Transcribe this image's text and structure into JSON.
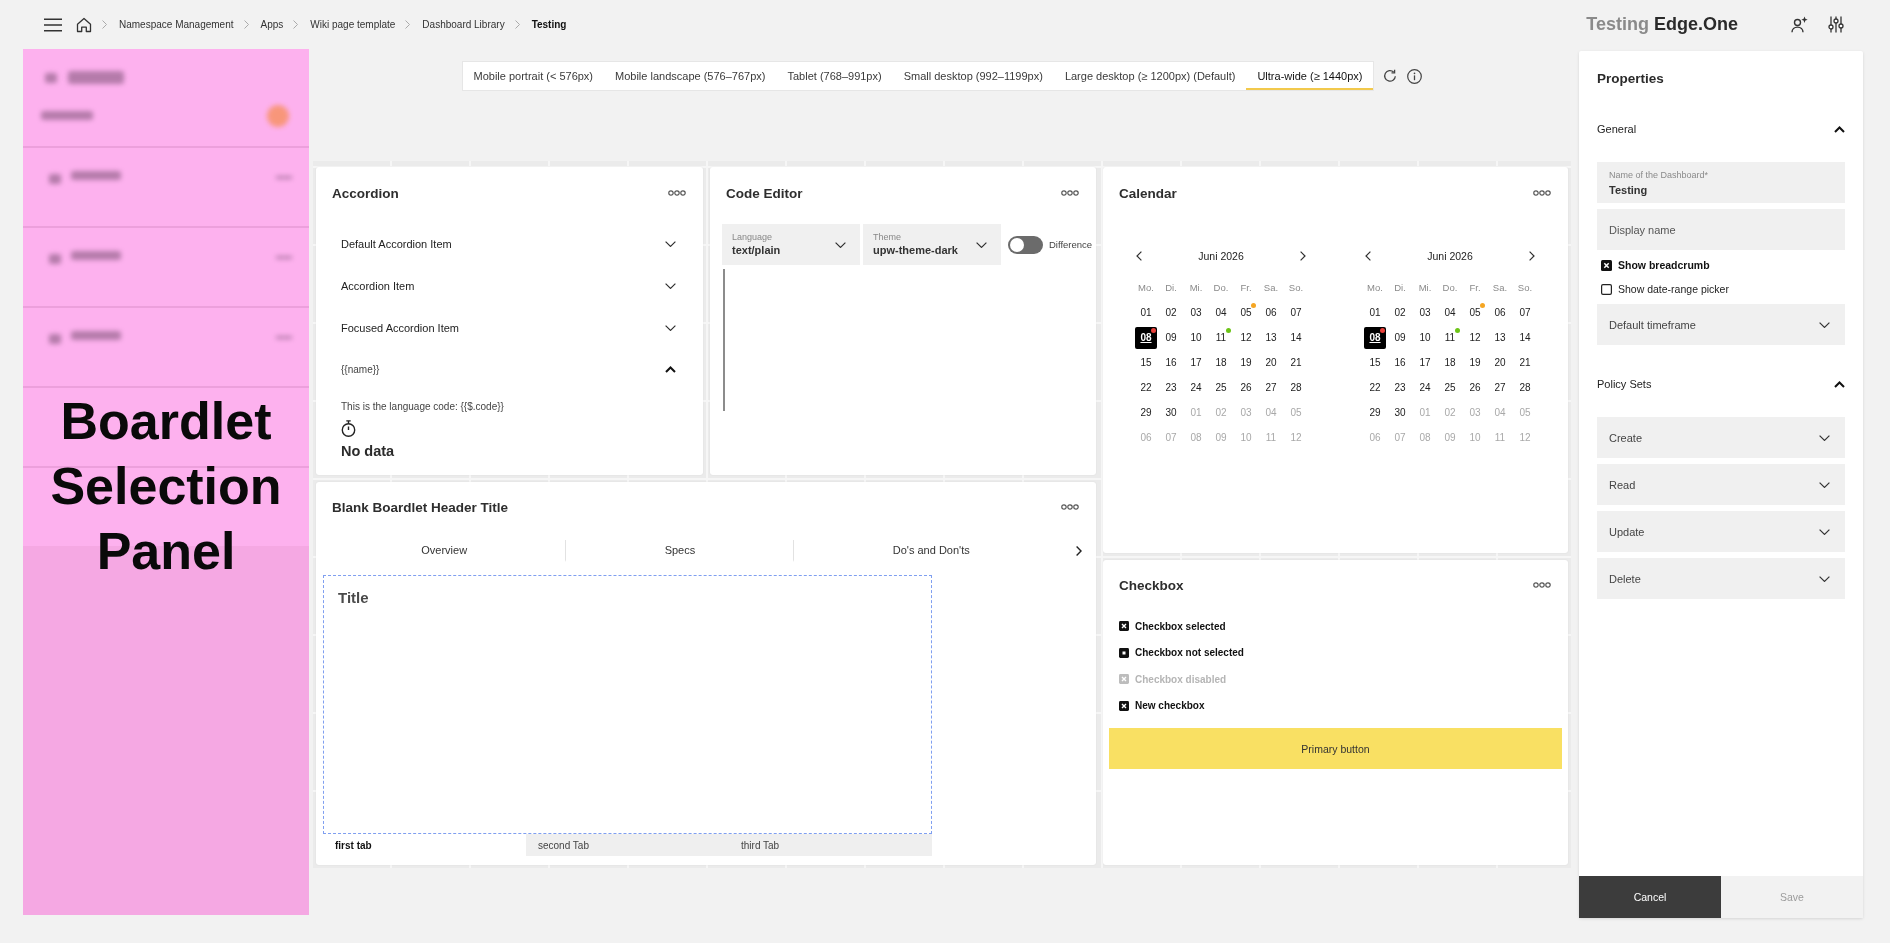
{
  "topbar": {
    "breadcrumb": [
      {
        "label": "Namespace Management",
        "current": false
      },
      {
        "label": "Apps",
        "current": false
      },
      {
        "label": "Wiki page template",
        "current": false
      },
      {
        "label": "Dashboard Library",
        "current": false
      },
      {
        "label": "Testing",
        "current": true
      }
    ],
    "brand": {
      "prefix": "Testing",
      "name": "Edge.One"
    }
  },
  "boardlet_panel": {
    "label": "Boardlet Selection Panel"
  },
  "breakpoints": {
    "tabs": [
      {
        "label": "Mobile portrait (< 576px)",
        "selected": false
      },
      {
        "label": "Mobile landscape (576–767px)",
        "selected": false
      },
      {
        "label": "Tablet (768–991px)",
        "selected": false
      },
      {
        "label": "Small desktop (992–1199px)",
        "selected": false
      },
      {
        "label": "Large desktop (≥ 1200px) (Default)",
        "selected": false
      },
      {
        "label": "Ultra-wide (≥ 1440px)",
        "selected": true
      }
    ]
  },
  "accordion": {
    "title": "Accordion",
    "items": [
      {
        "label": "Default Accordion Item",
        "expanded": false
      },
      {
        "label": "Accordion Item",
        "expanded": false
      },
      {
        "label": "Focused Accordion Item",
        "expanded": false
      },
      {
        "label": "{{name}}",
        "expanded": true,
        "content": "This is the language code: {{$.code}}",
        "empty_label": "No data"
      }
    ]
  },
  "code_editor": {
    "title": "Code Editor",
    "selects": [
      {
        "label": "Language",
        "value": "text/plain"
      },
      {
        "label": "Theme",
        "value": "upw-theme-dark"
      }
    ],
    "toggle": {
      "label": "Difference",
      "on": false
    }
  },
  "calendar": {
    "title": "Calendar",
    "months": [
      {
        "title": "Juni 2026",
        "weekdays": [
          "Mo.",
          "Di.",
          "Mi.",
          "Do.",
          "Fr.",
          "Sa.",
          "So."
        ],
        "days": [
          {
            "d": "01",
            "outside": false,
            "selected": false
          },
          {
            "d": "02",
            "outside": false,
            "selected": false
          },
          {
            "d": "03",
            "outside": false,
            "selected": false
          },
          {
            "d": "04",
            "outside": false,
            "selected": false
          },
          {
            "d": "05",
            "outside": false,
            "selected": false,
            "color": "#f5a623"
          },
          {
            "d": "06",
            "outside": false,
            "selected": false
          },
          {
            "d": "07",
            "outside": false,
            "selected": false
          },
          {
            "d": "08",
            "outside": false,
            "selected": true,
            "color": "#e8403a"
          },
          {
            "d": "09",
            "outside": false,
            "selected": false
          },
          {
            "d": "10",
            "outside": false,
            "selected": false
          },
          {
            "d": "11",
            "outside": false,
            "selected": false,
            "color": "#6cc417"
          },
          {
            "d": "12",
            "outside": false,
            "selected": false
          },
          {
            "d": "13",
            "outside": false,
            "selected": false
          },
          {
            "d": "14",
            "outside": false,
            "selected": false
          },
          {
            "d": "15",
            "outside": false,
            "selected": false
          },
          {
            "d": "16",
            "outside": false,
            "selected": false
          },
          {
            "d": "17",
            "outside": false,
            "selected": false
          },
          {
            "d": "18",
            "outside": false,
            "selected": false
          },
          {
            "d": "19",
            "outside": false,
            "selected": false
          },
          {
            "d": "20",
            "outside": false,
            "selected": false
          },
          {
            "d": "21",
            "outside": false,
            "selected": false
          },
          {
            "d": "22",
            "outside": false,
            "selected": false
          },
          {
            "d": "23",
            "outside": false,
            "selected": false
          },
          {
            "d": "24",
            "outside": false,
            "selected": false
          },
          {
            "d": "25",
            "outside": false,
            "selected": false
          },
          {
            "d": "26",
            "outside": false,
            "selected": false
          },
          {
            "d": "27",
            "outside": false,
            "selected": false
          },
          {
            "d": "28",
            "outside": false,
            "selected": false
          },
          {
            "d": "29",
            "outside": false,
            "selected": false
          },
          {
            "d": "30",
            "outside": false,
            "selected": false
          },
          {
            "d": "01",
            "outside": true,
            "selected": false
          },
          {
            "d": "02",
            "outside": true,
            "selected": false
          },
          {
            "d": "03",
            "outside": true,
            "selected": false
          },
          {
            "d": "04",
            "outside": true,
            "selected": false
          },
          {
            "d": "05",
            "outside": true,
            "selected": false
          },
          {
            "d": "06",
            "outside": true,
            "selected": false
          },
          {
            "d": "07",
            "outside": true,
            "selected": false
          },
          {
            "d": "08",
            "outside": true,
            "selected": false
          },
          {
            "d": "09",
            "outside": true,
            "selected": false
          },
          {
            "d": "10",
            "outside": true,
            "selected": false
          },
          {
            "d": "11",
            "outside": true,
            "selected": false
          },
          {
            "d": "12",
            "outside": true,
            "selected": false
          }
        ]
      },
      {
        "title": "Juni 2026",
        "weekdays": [
          "Mo.",
          "Di.",
          "Mi.",
          "Do.",
          "Fr.",
          "Sa.",
          "So."
        ],
        "days": [
          {
            "d": "01",
            "outside": false,
            "selected": false
          },
          {
            "d": "02",
            "outside": false,
            "selected": false
          },
          {
            "d": "03",
            "outside": false,
            "selected": false
          },
          {
            "d": "04",
            "outside": false,
            "selected": false
          },
          {
            "d": "05",
            "outside": false,
            "selected": false,
            "color": "#f5a623"
          },
          {
            "d": "06",
            "outside": false,
            "selected": false
          },
          {
            "d": "07",
            "outside": false,
            "selected": false
          },
          {
            "d": "08",
            "outside": false,
            "selected": true,
            "color": "#e8403a"
          },
          {
            "d": "09",
            "outside": false,
            "selected": false
          },
          {
            "d": "10",
            "outside": false,
            "selected": false
          },
          {
            "d": "11",
            "outside": false,
            "selected": false,
            "color": "#6cc417"
          },
          {
            "d": "12",
            "outside": false,
            "selected": false
          },
          {
            "d": "13",
            "outside": false,
            "selected": false
          },
          {
            "d": "14",
            "outside": false,
            "selected": false
          },
          {
            "d": "15",
            "outside": false,
            "selected": false
          },
          {
            "d": "16",
            "outside": false,
            "selected": false
          },
          {
            "d": "17",
            "outside": false,
            "selected": false
          },
          {
            "d": "18",
            "outside": false,
            "selected": false
          },
          {
            "d": "19",
            "outside": false,
            "selected": false
          },
          {
            "d": "20",
            "outside": false,
            "selected": false
          },
          {
            "d": "21",
            "outside": false,
            "selected": false
          },
          {
            "d": "22",
            "outside": false,
            "selected": false
          },
          {
            "d": "23",
            "outside": false,
            "selected": false
          },
          {
            "d": "24",
            "outside": false,
            "selected": false
          },
          {
            "d": "25",
            "outside": false,
            "selected": false
          },
          {
            "d": "26",
            "outside": false,
            "selected": false
          },
          {
            "d": "27",
            "outside": false,
            "selected": false
          },
          {
            "d": "28",
            "outside": false,
            "selected": false
          },
          {
            "d": "29",
            "outside": false,
            "selected": false
          },
          {
            "d": "30",
            "outside": false,
            "selected": false
          },
          {
            "d": "01",
            "outside": true,
            "selected": false
          },
          {
            "d": "02",
            "outside": true,
            "selected": false
          },
          {
            "d": "03",
            "outside": true,
            "selected": false
          },
          {
            "d": "04",
            "outside": true,
            "selected": false
          },
          {
            "d": "05",
            "outside": true,
            "selected": false
          },
          {
            "d": "06",
            "outside": true,
            "selected": false
          },
          {
            "d": "07",
            "outside": true,
            "selected": false
          },
          {
            "d": "08",
            "outside": true,
            "selected": false
          },
          {
            "d": "09",
            "outside": true,
            "selected": false
          },
          {
            "d": "10",
            "outside": true,
            "selected": false
          },
          {
            "d": "11",
            "outside": true,
            "selected": false
          },
          {
            "d": "12",
            "outside": true,
            "selected": false
          }
        ]
      }
    ]
  },
  "blank_boardlet": {
    "title": "Blank Boardlet Header Title",
    "tabs": [
      {
        "label": "Overview",
        "selected": false
      },
      {
        "label": "Specs",
        "selected": false
      },
      {
        "label": "Do's and Don'ts",
        "selected": false
      }
    ],
    "content_title": "Title",
    "bottom_tabs": [
      {
        "label": "first tab",
        "selected": true
      },
      {
        "label": "second Tab",
        "selected": false
      },
      {
        "label": "third Tab",
        "selected": false
      }
    ]
  },
  "checkbox": {
    "title": "Checkbox",
    "items": [
      {
        "label": "Checkbox selected",
        "checked": true,
        "disabled": false
      },
      {
        "label": "Checkbox not selected",
        "checked": false,
        "disabled": false
      },
      {
        "label": "Checkbox disabled",
        "checked": true,
        "disabled": true
      },
      {
        "label": "New checkbox",
        "checked": true,
        "disabled": false
      }
    ],
    "button": "Primary button"
  },
  "properties": {
    "title": "Properties",
    "sections": [
      {
        "title": "General",
        "expanded": true,
        "fields": [
          {
            "kind": "text",
            "label": "Name of the Dashboard*",
            "value": "Testing"
          },
          {
            "kind": "text",
            "placeholder": "Display name"
          },
          {
            "kind": "checkbox",
            "label": "Show breadcrumb",
            "checked": true
          },
          {
            "kind": "checkbox",
            "label": "Show date-range picker",
            "checked": false
          },
          {
            "kind": "select",
            "placeholder": "Default timeframe"
          }
        ]
      },
      {
        "title": "Policy Sets",
        "expanded": true,
        "fields": [
          {
            "kind": "select",
            "placeholder": "Create"
          },
          {
            "kind": "select",
            "placeholder": "Read"
          },
          {
            "kind": "select",
            "placeholder": "Update"
          },
          {
            "kind": "select",
            "placeholder": "Delete"
          }
        ]
      }
    ],
    "buttons": [
      {
        "label": "Cancel",
        "disabled": false
      },
      {
        "label": "Save",
        "disabled": true
      }
    ]
  }
}
